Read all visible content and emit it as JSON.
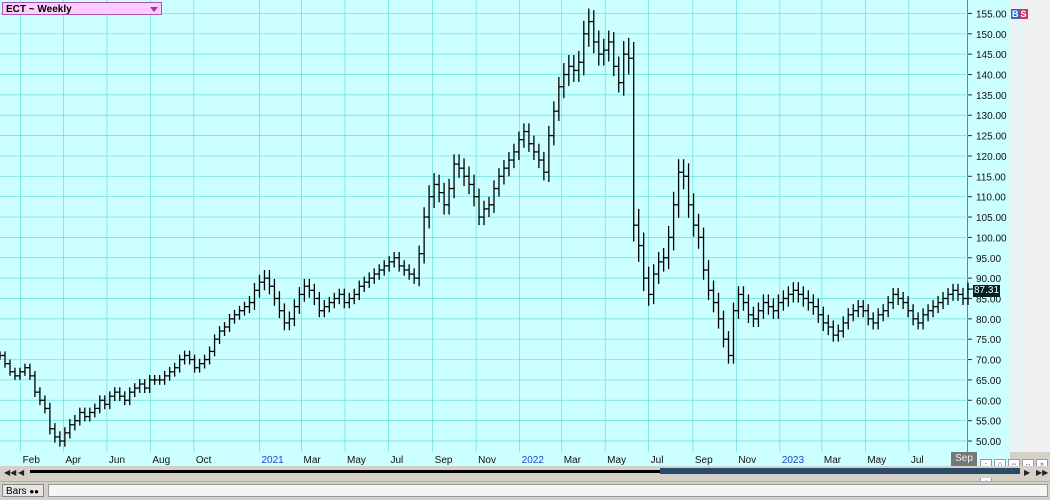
{
  "title": "ECT ~ Weekly",
  "badge": {
    "b": "B",
    "s": "S"
  },
  "last_price": "87.31",
  "bottom": {
    "bars_label": "Bars"
  },
  "x_current_label": "Sep",
  "chart_data": {
    "type": "ohlc",
    "title": "ECT ~ Weekly",
    "yticks": [
      50,
      55,
      60,
      65,
      70,
      75,
      80,
      85,
      90,
      95,
      100,
      105,
      110,
      115,
      120,
      125,
      130,
      135,
      140,
      145,
      150,
      155
    ],
    "ytick_labels": [
      "50.00",
      "55.00",
      "60.00",
      "65.00",
      "70.00",
      "75.00",
      "80.00",
      "85.00",
      "90.00",
      "95.00",
      "100.00",
      "105.00",
      "110.00",
      "115.00",
      "120.00",
      "125.00",
      "130.00",
      "135.00",
      "140.00",
      "145.00",
      "150.00",
      "155.00"
    ],
    "ylim": [
      47.3,
      158.3
    ],
    "xlim": [
      "2020-01-03",
      "2023-09-22"
    ],
    "xticks": [
      {
        "label": "Feb",
        "date": "2020-02-01"
      },
      {
        "label": "Apr",
        "date": "2020-04-01"
      },
      {
        "label": "Jun",
        "date": "2020-06-01"
      },
      {
        "label": "Aug",
        "date": "2020-08-01"
      },
      {
        "label": "Oct",
        "date": "2020-10-01"
      },
      {
        "label": "2021",
        "date": "2021-01-01",
        "year": true
      },
      {
        "label": "Mar",
        "date": "2021-03-01"
      },
      {
        "label": "May",
        "date": "2021-05-01"
      },
      {
        "label": "Jul",
        "date": "2021-07-01"
      },
      {
        "label": "Sep",
        "date": "2021-09-01"
      },
      {
        "label": "Nov",
        "date": "2021-11-01"
      },
      {
        "label": "2022",
        "date": "2022-01-01",
        "year": true
      },
      {
        "label": "Mar",
        "date": "2022-03-01"
      },
      {
        "label": "May",
        "date": "2022-05-01"
      },
      {
        "label": "Jul",
        "date": "2022-07-01"
      },
      {
        "label": "Sep",
        "date": "2022-09-01"
      },
      {
        "label": "Nov",
        "date": "2022-11-01"
      },
      {
        "label": "2023",
        "date": "2023-01-01",
        "year": true
      },
      {
        "label": "Mar",
        "date": "2023-03-01"
      },
      {
        "label": "May",
        "date": "2023-05-01"
      },
      {
        "label": "Jul",
        "date": "2023-07-01"
      }
    ],
    "series": [
      {
        "start": "2020-01-03",
        "interval_days": 7,
        "close": [
          71,
          69,
          67,
          66,
          67,
          68,
          66,
          62,
          60,
          58,
          53,
          51,
          50,
          52,
          54,
          55,
          57,
          56,
          57,
          58,
          60,
          59,
          61,
          62,
          61,
          60,
          62,
          63,
          64,
          63,
          65,
          65,
          65,
          66,
          67,
          68,
          70,
          71,
          70,
          68,
          69,
          70,
          72,
          75,
          77,
          78,
          80,
          81,
          82,
          83,
          84,
          87,
          89,
          90,
          88,
          85,
          82,
          79,
          80,
          83,
          86,
          88,
          87,
          85,
          82,
          83,
          84,
          85,
          86,
          84,
          85,
          86,
          88,
          89,
          90,
          91,
          92,
          93,
          94,
          95,
          93,
          92,
          91,
          90,
          96,
          105,
          110,
          113,
          111,
          108,
          112,
          118,
          117,
          115,
          113,
          110,
          105,
          107,
          108,
          112,
          115,
          117,
          119,
          121,
          124,
          126,
          123,
          121,
          119,
          116,
          125,
          131,
          137,
          140,
          142,
          141,
          143,
          150,
          153,
          148,
          145,
          146,
          148,
          142,
          138,
          145,
          144,
          103,
          98,
          90,
          86,
          91,
          94,
          95,
          100,
          108,
          116,
          115,
          108,
          103,
          100,
          92,
          87,
          84,
          80,
          75,
          71,
          82,
          86,
          84,
          81,
          80,
          82,
          84,
          83,
          82,
          84,
          85,
          86,
          87,
          86,
          85,
          84,
          83,
          81,
          79,
          78,
          76,
          77,
          79,
          81,
          82,
          83,
          82,
          80,
          79,
          81,
          82,
          84,
          86,
          85,
          84,
          82,
          80,
          79,
          81,
          82,
          83,
          84,
          85,
          86,
          87,
          86,
          85,
          87.31
        ],
        "range": [
          2.5,
          2.5,
          2.5,
          2.5,
          2.5,
          2.5,
          2.5,
          3,
          3,
          3,
          3.5,
          3.5,
          3.5,
          3.5,
          3.5,
          3.5,
          3,
          3,
          3,
          3,
          3,
          3,
          3,
          3,
          3,
          3,
          3,
          3,
          3,
          3,
          3,
          3,
          3,
          3,
          3,
          3,
          3,
          3,
          3,
          3,
          3,
          3,
          3,
          3,
          3,
          3,
          3,
          3,
          3,
          3,
          4,
          4.5,
          4.5,
          5,
          5,
          4.5,
          4.5,
          4.5,
          4.5,
          4.5,
          4.5,
          4.5,
          4.5,
          4,
          4,
          4,
          3.5,
          3.5,
          3.5,
          3.5,
          3.5,
          3.5,
          3.5,
          3.5,
          3.5,
          3.5,
          3.5,
          3.5,
          3.5,
          3.5,
          3.5,
          3.5,
          3.5,
          3.5,
          5,
          6,
          7,
          7,
          6,
          6,
          6,
          6,
          6,
          6,
          6,
          6,
          5,
          5,
          5,
          5,
          5,
          5,
          5,
          5,
          5,
          5,
          5,
          5,
          5,
          5,
          6,
          6,
          6,
          7,
          7,
          7,
          7,
          8,
          8,
          7,
          7,
          7,
          7,
          6,
          6,
          8,
          10,
          10,
          10,
          8,
          7,
          6,
          6,
          6,
          7,
          8,
          8,
          8,
          8,
          7,
          7,
          6,
          6,
          6,
          6,
          5,
          5,
          5,
          5,
          5,
          5,
          5,
          5,
          5,
          5,
          5,
          5,
          5,
          5,
          5,
          5,
          5,
          5,
          5,
          5,
          5,
          5,
          4,
          4,
          4,
          4,
          4,
          4,
          4,
          4,
          4,
          4,
          4,
          4,
          4,
          4,
          4,
          4,
          4,
          4,
          4,
          4,
          4,
          4,
          4,
          4,
          4,
          4,
          4,
          4,
          4,
          4
        ]
      }
    ]
  }
}
